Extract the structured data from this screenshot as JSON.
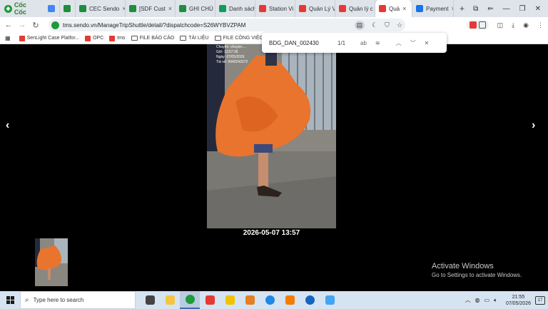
{
  "browser": {
    "brand": "Cốc Cốc",
    "tabs": [
      {
        "label": "",
        "color": "#4285f4",
        "active": false
      },
      {
        "label": "",
        "color": "#1e8e3e",
        "active": false
      },
      {
        "label": "CEC Sendo",
        "color": "#1e8e3e",
        "active": false
      },
      {
        "label": "[SDF Cust",
        "color": "#1e8e3e",
        "active": false
      },
      {
        "label": "GHI CHÚ",
        "color": "#1e8e3e",
        "active": false
      },
      {
        "label": "Danh sách",
        "color": "#0f9d58",
        "active": false
      },
      {
        "label": "Station Vi",
        "color": "#e53935",
        "active": false
      },
      {
        "label": "Quản Lý V",
        "color": "#e53935",
        "active": false
      },
      {
        "label": "Quản lý c",
        "color": "#e53935",
        "active": false
      },
      {
        "label": "Quả",
        "color": "#e53935",
        "active": true
      },
      {
        "label": "Payment",
        "color": "#1a73e8",
        "active": false
      }
    ],
    "new_tab": "+",
    "url": "tms.sendo.vn/ManageTripShuttle/detail/?dispatchcode=S26WYBVZPAM",
    "bookmarks": [
      {
        "label": "SenLight Case Platfor...",
        "type": "site",
        "color": "#e53935"
      },
      {
        "label": "OPC",
        "type": "site",
        "color": "#e53935"
      },
      {
        "label": "tms",
        "type": "site",
        "color": "#e53935"
      },
      {
        "label": "FILE BÁO CÁO",
        "type": "folder"
      },
      {
        "label": "TÀI LIỆU",
        "type": "folder"
      },
      {
        "label": "FILE CÔNG VIỆC",
        "type": "folder"
      }
    ]
  },
  "find_bar": {
    "query": "BDG_DAN_002430",
    "count": "1/1",
    "match_case": "ab"
  },
  "viewer": {
    "prev": "‹",
    "next": "›",
    "photo_overlay": [
      "Chuyến: chuyen-...",
      "Giờ: 13:57:36",
      "Ngày: 07/05/2026",
      "Tài xế: 0942243272"
    ],
    "caption": "2026-05-07 13:57"
  },
  "watermark": {
    "title": "Activate Windows",
    "subtitle": "Go to Settings to activate Windows."
  },
  "taskbar": {
    "search_placeholder": "Type here to search",
    "apps": [
      {
        "name": "task-view",
        "color": "#444"
      },
      {
        "name": "file-explorer",
        "color": "#f4c542"
      },
      {
        "name": "coccoc",
        "color": "#1f9a3a"
      },
      {
        "name": "wps",
        "color": "#e53935"
      },
      {
        "name": "sticky-notes",
        "color": "#f2c200"
      },
      {
        "name": "app-orange",
        "color": "#e67e22"
      },
      {
        "name": "edge",
        "color": "#1e88e5"
      },
      {
        "name": "app-fire",
        "color": "#f57c00"
      },
      {
        "name": "zalo",
        "color": "#1565c0"
      },
      {
        "name": "app-blue",
        "color": "#42a5f5"
      }
    ],
    "time": "21:55",
    "date": "07/05/2026",
    "notifications": "17"
  }
}
